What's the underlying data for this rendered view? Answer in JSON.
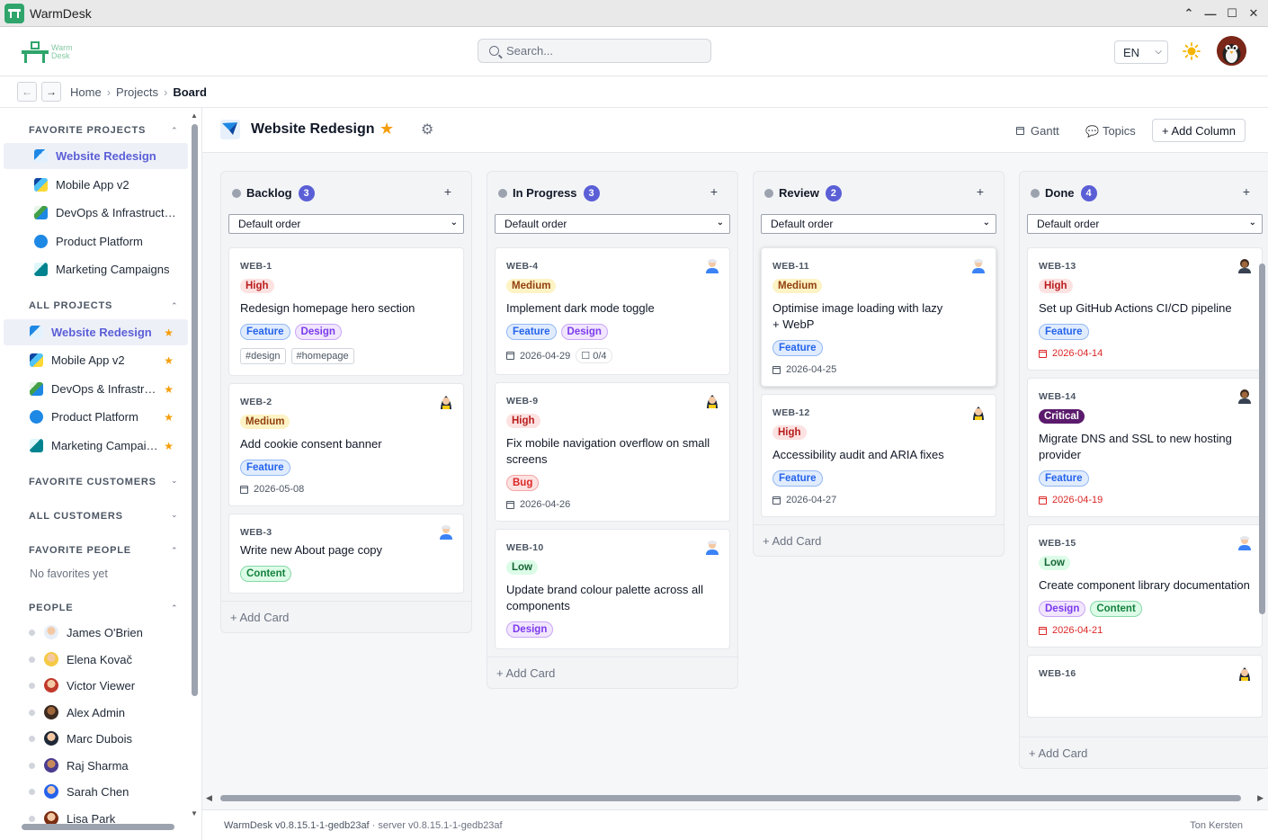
{
  "window": {
    "title": "WarmDesk",
    "controls": [
      "⌃",
      "—",
      "☐",
      "✕"
    ]
  },
  "header": {
    "logo_text_1": "Warm",
    "logo_text_2": "Desk",
    "search_placeholder": "Search...",
    "language": "EN",
    "theme_icon": "sun-icon"
  },
  "breadcrumb": {
    "back": "←",
    "forward": "→",
    "items": [
      "Home",
      "Projects",
      "Board"
    ]
  },
  "sidebar": {
    "favorite_projects_title": "FAVORITE PROJECTS",
    "favorite_projects": [
      "Website Redesign",
      "Mobile App v2",
      "DevOps & Infrastruct…",
      "Product Platform",
      "Marketing Campaigns"
    ],
    "all_projects_title": "ALL PROJECTS",
    "all_projects": [
      "Website Redesign",
      "Mobile App v2",
      "DevOps & Infrastru…",
      "Product Platform",
      "Marketing Campai…"
    ],
    "favorite_customers_title": "FAVORITE CUSTOMERS",
    "all_customers_title": "ALL CUSTOMERS",
    "favorite_people_title": "FAVORITE PEOPLE",
    "favorite_people_empty": "No favorites yet",
    "people_title": "PEOPLE",
    "people": [
      "James O'Brien",
      "Elena Kovač",
      "Victor Viewer",
      "Alex Admin",
      "Marc Dubois",
      "Raj Sharma",
      "Sarah Chen",
      "Lisa Park"
    ]
  },
  "project": {
    "title": "Website Redesign",
    "gantt": "Gantt",
    "topics": "Topics",
    "add_column": "+ Add Column"
  },
  "board": {
    "sort_label": "Default order",
    "add_card": "+ Add Card",
    "columns": [
      {
        "name": "Backlog",
        "count": "3",
        "cards": [
          {
            "id": "WEB-1",
            "priority": "High",
            "title": "Redesign homepage hero section",
            "tags": [
              "Feature",
              "Design"
            ],
            "hashtags": [
              "#design",
              "#homepage"
            ]
          },
          {
            "id": "WEB-2",
            "priority": "Medium",
            "title": "Add cookie consent banner",
            "tags": [
              "Feature"
            ],
            "date": "2026-05-08"
          },
          {
            "id": "WEB-3",
            "title": "Write new About page copy",
            "tags": [
              "Content"
            ]
          }
        ]
      },
      {
        "name": "In Progress",
        "count": "3",
        "cards": [
          {
            "id": "WEB-4",
            "priority": "Medium",
            "title": "Implement dark mode toggle",
            "tags": [
              "Feature",
              "Design"
            ],
            "date": "2026-04-29",
            "checklist": "0/4"
          },
          {
            "id": "WEB-9",
            "priority": "High",
            "title": "Fix mobile navigation overflow on small screens",
            "tags": [
              "Bug"
            ],
            "date": "2026-04-26"
          },
          {
            "id": "WEB-10",
            "priority": "Low",
            "title": "Update brand colour palette across all components",
            "tags": [
              "Design"
            ]
          }
        ]
      },
      {
        "name": "Review",
        "count": "2",
        "cards": [
          {
            "id": "WEB-11",
            "priority": "Medium",
            "title": "Optimise image loading with lazy + WebP",
            "tags": [
              "Feature"
            ],
            "date": "2026-04-25"
          },
          {
            "id": "WEB-12",
            "priority": "High",
            "title": "Accessibility audit and ARIA fixes",
            "tags": [
              "Feature"
            ],
            "date": "2026-04-27"
          }
        ]
      },
      {
        "name": "Done",
        "count": "4",
        "cards": [
          {
            "id": "WEB-13",
            "priority": "High",
            "title": "Set up GitHub Actions CI/CD pipeline",
            "tags": [
              "Feature"
            ],
            "date": "2026-04-14"
          },
          {
            "id": "WEB-14",
            "priority": "Critical",
            "title": "Migrate DNS and SSL to new hosting provider",
            "tags": [
              "Feature"
            ],
            "date": "2026-04-19"
          },
          {
            "id": "WEB-15",
            "priority": "Low",
            "title": "Create component library documentation",
            "tags": [
              "Design",
              "Content"
            ],
            "date": "2026-04-21"
          },
          {
            "id": "WEB-16"
          }
        ]
      }
    ]
  },
  "footer": {
    "client_version": "WarmDesk v0.8.15.1-1-gedb23af",
    "server_version": " · server v0.8.15.1-1-gedb23af",
    "user": "Ton Kersten"
  },
  "colors": {
    "accent": "#5b5fd6",
    "brand": "#2fa56b",
    "star": "#f59e0b"
  }
}
